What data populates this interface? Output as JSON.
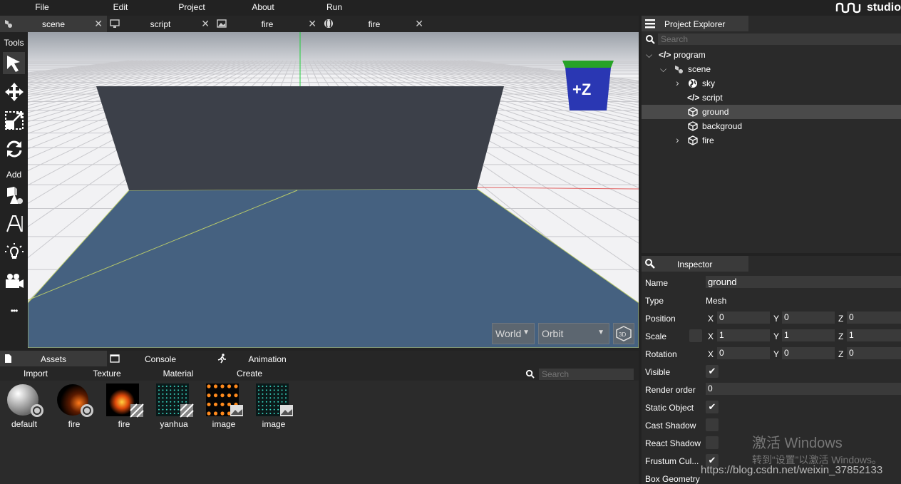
{
  "menu": {
    "items": [
      "File",
      "Edit",
      "Project",
      "About",
      "Run"
    ],
    "logo_text": "studio"
  },
  "tabs": [
    {
      "label": "scene",
      "icon": "scene-icon",
      "active": true
    },
    {
      "label": "script",
      "icon": "monitor-icon",
      "active": false
    },
    {
      "label": "fire",
      "icon": "image-icon",
      "active": false
    },
    {
      "label": "fire",
      "icon": "particle-icon",
      "active": false
    }
  ],
  "tools": {
    "tools_heading": "Tools",
    "add_heading": "Add",
    "more": "•••"
  },
  "viewport": {
    "world_select": "World",
    "orbit_select": "Orbit",
    "gizmo_label": "+Z",
    "colors": {
      "sky": "#e9e9ec",
      "wall": "#3c4049",
      "floor": "#456180",
      "gizmo": "#2a37b3",
      "gizmo_top": "#27a327"
    }
  },
  "explorer": {
    "title": "Project Explorer",
    "search_placeholder": "Search",
    "tree": [
      {
        "label": "program",
        "icon": "code-icon",
        "expanded": true,
        "level": 0
      },
      {
        "label": "scene",
        "icon": "scene-icon",
        "expanded": true,
        "level": 1
      },
      {
        "label": "sky",
        "icon": "globe-icon",
        "collapsed": true,
        "level": 2
      },
      {
        "label": "script",
        "icon": "code-icon",
        "level": 2
      },
      {
        "label": "ground",
        "icon": "cube-icon",
        "level": 2,
        "selected": true
      },
      {
        "label": "backgroud",
        "icon": "cube-icon",
        "level": 2
      },
      {
        "label": "fire",
        "icon": "cube-icon",
        "collapsed": true,
        "level": 2
      }
    ]
  },
  "inspector": {
    "title": "Inspector",
    "name_label": "Name",
    "name_value": "ground",
    "type_label": "Type",
    "type_value": "Mesh",
    "position_label": "Position",
    "position": {
      "x": "0",
      "y": "0",
      "z": "0"
    },
    "scale_label": "Scale",
    "scale": {
      "x": "1",
      "y": "1",
      "z": "1"
    },
    "rotation_label": "Rotation",
    "rotation": {
      "x": "0",
      "y": "0",
      "z": "0"
    },
    "axis_x": "X",
    "axis_y": "Y",
    "axis_z": "Z",
    "visible_label": "Visible",
    "visible": true,
    "render_order_label": "Render order",
    "render_order": "0",
    "static_label": "Static Object",
    "static": true,
    "cast_shadow_label": "Cast Shadow",
    "cast_shadow": false,
    "react_shadow_label": "React Shadow",
    "react_shadow": false,
    "frustum_label": "Frustum Cul...",
    "frustum": true,
    "box_geometry_label": "Box Geometry",
    "check_mark": "✔"
  },
  "watermark": {
    "title": "激活 Windows",
    "subtitle": "转到“设置”以激活 Windows。",
    "url": "https://blog.csdn.net/weixin_37852133"
  },
  "assets": {
    "tabs": [
      "Assets",
      "Console",
      "Animation"
    ],
    "toolbar": [
      "Import",
      "Texture",
      "Material",
      "Create"
    ],
    "search_placeholder": "Search",
    "items": [
      {
        "label": "default",
        "kind": "material"
      },
      {
        "label": "fire",
        "kind": "material"
      },
      {
        "label": "fire",
        "kind": "texture"
      },
      {
        "label": "yanhua",
        "kind": "texture"
      },
      {
        "label": "image",
        "kind": "image"
      },
      {
        "label": "image",
        "kind": "image"
      }
    ]
  }
}
